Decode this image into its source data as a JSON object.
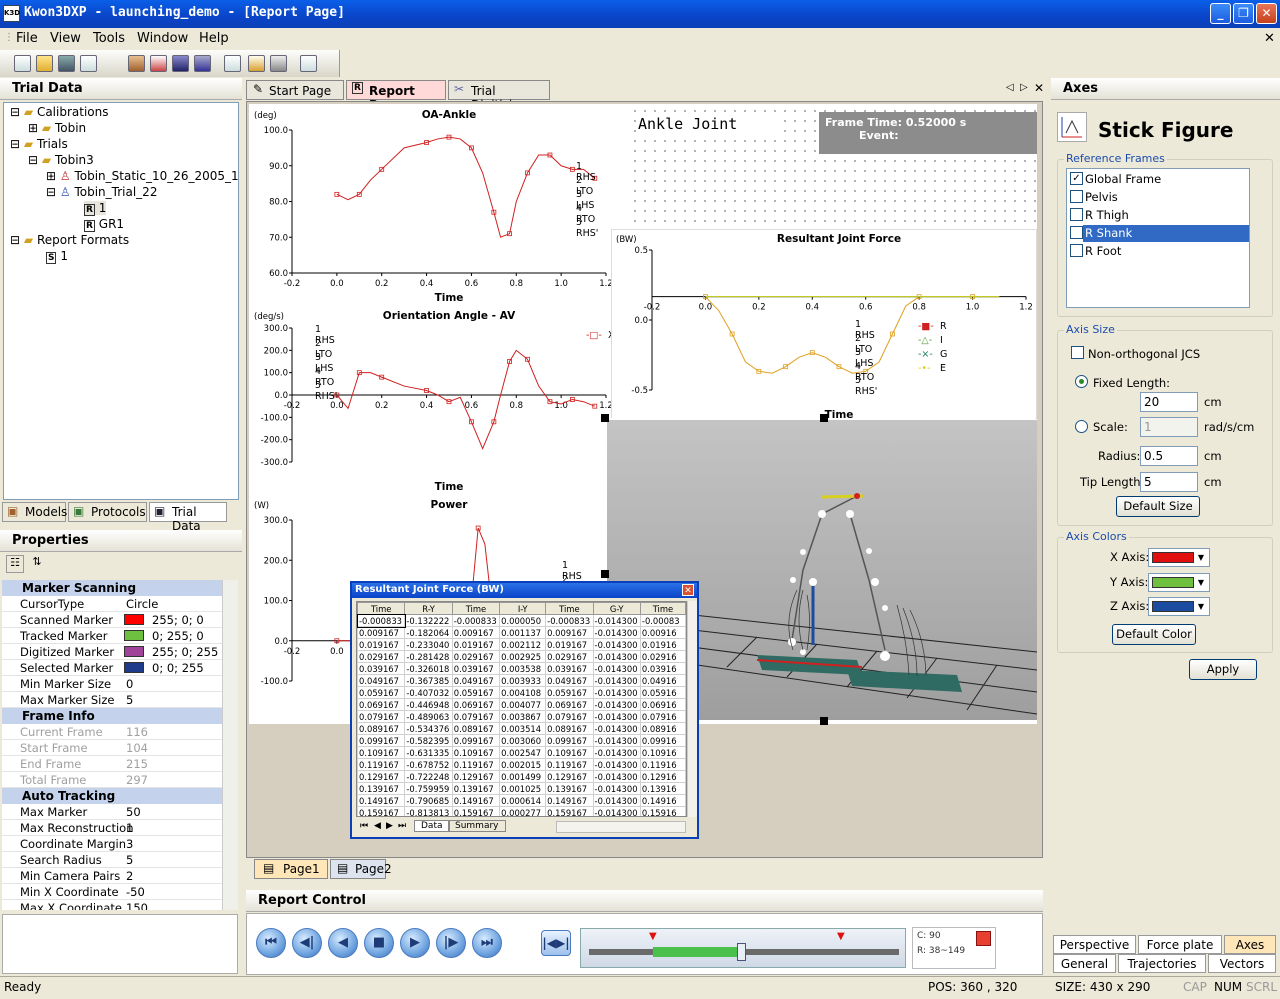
{
  "window": {
    "title": "Kwon3DXP - launching_demo - [Report Page]",
    "app_icon": "K3D"
  },
  "menu": [
    "File",
    "View",
    "Tools",
    "Window",
    "Help"
  ],
  "trial_data": {
    "title": "Trial Data",
    "tree": [
      "Calibrations",
      "Tobin",
      "Trials",
      "Tobin3",
      "Tobin_Static_10_26_2005_1",
      "Tobin_Trial_22",
      "1",
      "GR1",
      "Report Formats",
      "1"
    ]
  },
  "left_tabs": [
    "Models",
    "Protocols",
    "Trial Data"
  ],
  "properties": {
    "title": "Properties",
    "cat1": "Marker Scanning",
    "r1": [
      "CursorType",
      "Circle"
    ],
    "r2": [
      "Scanned Marker",
      "255; 0; 0"
    ],
    "r3": [
      "Tracked Marker",
      "0; 255; 0"
    ],
    "r4": [
      "Digitized Marker",
      "255; 0; 255"
    ],
    "r5": [
      "Selected Marker",
      "0; 0; 255"
    ],
    "r6": [
      "Min Marker Size",
      "0"
    ],
    "r7": [
      "Max Marker Size",
      "5"
    ],
    "cat2": "Frame Info",
    "r8": [
      "Current Frame",
      "116"
    ],
    "r9": [
      "Start Frame",
      "104"
    ],
    "r10": [
      "End Frame",
      "215"
    ],
    "r11": [
      "Total Frame",
      "297"
    ],
    "cat3": "Auto Tracking",
    "r12": [
      "Max Marker",
      "50"
    ],
    "r13": [
      "Max Reconstruction",
      "1"
    ],
    "r14": [
      "Coordinate Margin",
      "3"
    ],
    "r15": [
      "Search Radius",
      "5"
    ],
    "r16": [
      "Min Camera Pairs",
      "2"
    ],
    "r17": [
      "Min X Coordinate",
      "-50"
    ],
    "r18": [
      "Max X Coordinate",
      "150"
    ]
  },
  "doc_tabs": [
    "Start Page",
    "Report Page",
    "Trial Digitizing"
  ],
  "page_tabs": [
    "Page1",
    "Page2"
  ],
  "report_header": {
    "joint": "Ankle Joint",
    "frame_time": "Frame Time: 0.52000 s",
    "event": "Event:"
  },
  "legend_events": [
    "1 RHS",
    "2 LTO",
    "3 LHS",
    "4 RTO",
    "5 RHS'"
  ],
  "chart_data": [
    {
      "type": "line",
      "title": "OA-Ankle",
      "ylabel": "(deg)",
      "xlabel": "Time",
      "xlim": [
        -0.2,
        1.2
      ],
      "ylim": [
        60,
        100
      ],
      "yticks": [
        "100.0",
        "90.0",
        "80.0",
        "70.0",
        "60.0"
      ],
      "xticks": [
        "-0.2",
        "0.0",
        "0.2",
        "0.4",
        "0.6",
        "0.8",
        "1.0",
        "1.2"
      ],
      "x": [
        0.0,
        0.05,
        0.1,
        0.15,
        0.2,
        0.3,
        0.4,
        0.45,
        0.5,
        0.55,
        0.6,
        0.65,
        0.7,
        0.73,
        0.77,
        0.8,
        0.85,
        0.9,
        0.95,
        1.0,
        1.05,
        1.1,
        1.15
      ],
      "y": [
        82,
        80.5,
        82,
        86,
        89,
        95,
        96.5,
        97.5,
        98,
        97.5,
        95,
        88,
        77,
        70,
        71,
        80,
        88,
        93,
        93,
        90,
        89,
        89,
        86.5
      ]
    },
    {
      "type": "line",
      "title": "Orientation Angle - AV",
      "ylabel": "(deg/s)",
      "xlabel": "Time",
      "xlim": [
        -0.2,
        1.2
      ],
      "ylim": [
        -300,
        300
      ],
      "yticks": [
        "300.0",
        "200.0",
        "100.0",
        "0.0",
        "-100.0",
        "-200.0",
        "-300.0"
      ],
      "xticks": [
        "-0.2",
        "0.0",
        "0.2",
        "0.4",
        "0.6",
        "0.8",
        "1.0",
        "1.2"
      ],
      "series": [
        {
          "name": "X",
          "x": [
            0.0,
            0.05,
            0.1,
            0.15,
            0.2,
            0.3,
            0.4,
            0.45,
            0.5,
            0.55,
            0.6,
            0.65,
            0.7,
            0.73,
            0.77,
            0.8,
            0.85,
            0.9,
            0.95,
            1.0,
            1.05,
            1.1,
            1.15
          ],
          "y": [
            0,
            -60,
            100,
            100,
            80,
            40,
            20,
            0,
            -30,
            -10,
            -120,
            -240,
            -120,
            0,
            150,
            200,
            160,
            40,
            -30,
            -40,
            -20,
            -30,
            -50
          ]
        }
      ]
    },
    {
      "type": "line",
      "title": "Power",
      "ylabel": "(W)",
      "xlabel": "Time",
      "xlim": [
        -0.2,
        1.2
      ],
      "ylim": [
        -100,
        300
      ],
      "yticks": [
        "300.0",
        "200.0",
        "100.0",
        "0.0",
        "-100.0"
      ],
      "xticks": [
        "-0.2",
        "0.0"
      ],
      "x": [
        0.0,
        0.1,
        0.2,
        0.3,
        0.4,
        0.5,
        0.55,
        0.6,
        0.63,
        0.66,
        0.7,
        0.75,
        0.8
      ],
      "y": [
        0,
        0,
        0,
        0,
        0,
        0,
        -5,
        100,
        280,
        240,
        40,
        0,
        0
      ]
    },
    {
      "type": "line",
      "title": "Resultant Joint Force",
      "ylabel": "(BW)",
      "xlabel": "Time",
      "xlim": [
        -0.2,
        1.2
      ],
      "ylim": [
        -1.0,
        0.5
      ],
      "yticks": [
        "0.5",
        "0.0",
        "-0.5"
      ],
      "xticks": [
        "-0.2",
        "0.0",
        "0.2",
        "0.4",
        "0.6",
        "0.8",
        "1.0",
        "1.2"
      ],
      "series": [
        {
          "name": "R",
          "x": [
            0.0,
            0.05,
            0.1,
            0.15,
            0.2,
            0.25,
            0.3,
            0.35,
            0.4,
            0.45,
            0.5,
            0.55,
            0.6,
            0.65,
            0.7,
            0.75,
            0.8,
            0.9,
            1.0,
            1.1
          ],
          "y": [
            0,
            -0.15,
            -0.4,
            -0.7,
            -0.8,
            -0.82,
            -0.75,
            -0.65,
            -0.6,
            -0.65,
            -0.75,
            -0.82,
            -0.8,
            -0.7,
            -0.4,
            -0.1,
            0,
            0,
            0,
            0
          ]
        },
        {
          "name": "I",
          "x": [
            0,
            1.1
          ],
          "y": [
            0,
            0
          ]
        },
        {
          "name": "G",
          "x": [
            0,
            1.1
          ],
          "y": [
            0,
            0
          ]
        },
        {
          "name": "E",
          "x": [
            0,
            1.1
          ],
          "y": [
            0,
            0
          ]
        }
      ]
    }
  ],
  "table": {
    "title": "Resultant Joint Force (BW)",
    "headers": [
      "Time",
      "R-Y",
      "Time",
      "I-Y",
      "Time",
      "G-Y",
      "Time"
    ],
    "rows": [
      [
        "-0.000833",
        "-0.132222",
        "-0.000833",
        "0.000050",
        "-0.000833",
        "-0.014300",
        "-0.00083"
      ],
      [
        "0.009167",
        "-0.182064",
        "0.009167",
        "0.001137",
        "0.009167",
        "-0.014300",
        "0.00916"
      ],
      [
        "0.019167",
        "-0.233040",
        "0.019167",
        "0.002112",
        "0.019167",
        "-0.014300",
        "0.01916"
      ],
      [
        "0.029167",
        "-0.281428",
        "0.029167",
        "0.002925",
        "0.029167",
        "-0.014300",
        "0.02916"
      ],
      [
        "0.039167",
        "-0.326018",
        "0.039167",
        "0.003538",
        "0.039167",
        "-0.014300",
        "0.03916"
      ],
      [
        "0.049167",
        "-0.367385",
        "0.049167",
        "0.003933",
        "0.049167",
        "-0.014300",
        "0.04916"
      ],
      [
        "0.059167",
        "-0.407032",
        "0.059167",
        "0.004108",
        "0.059167",
        "-0.014300",
        "0.05916"
      ],
      [
        "0.069167",
        "-0.446948",
        "0.069167",
        "0.004077",
        "0.069167",
        "-0.014300",
        "0.06916"
      ],
      [
        "0.079167",
        "-0.489063",
        "0.079167",
        "0.003867",
        "0.079167",
        "-0.014300",
        "0.07916"
      ],
      [
        "0.089167",
        "-0.534376",
        "0.089167",
        "0.003514",
        "0.089167",
        "-0.014300",
        "0.08916"
      ],
      [
        "0.099167",
        "-0.582395",
        "0.099167",
        "0.003060",
        "0.099167",
        "-0.014300",
        "0.09916"
      ],
      [
        "0.109167",
        "-0.631335",
        "0.109167",
        "0.002547",
        "0.109167",
        "-0.014300",
        "0.10916"
      ],
      [
        "0.119167",
        "-0.678752",
        "0.119167",
        "0.002015",
        "0.119167",
        "-0.014300",
        "0.11916"
      ],
      [
        "0.129167",
        "-0.722248",
        "0.129167",
        "0.001499",
        "0.129167",
        "-0.014300",
        "0.12916"
      ],
      [
        "0.139167",
        "-0.759959",
        "0.139167",
        "0.001025",
        "0.139167",
        "-0.014300",
        "0.13916"
      ],
      [
        "0.149167",
        "-0.790685",
        "0.149167",
        "0.000614",
        "0.149167",
        "-0.014300",
        "0.14916"
      ],
      [
        "0.159167",
        "-0.813813",
        "0.159167",
        "0.000277",
        "0.159167",
        "-0.014300",
        "0.15916"
      ]
    ],
    "sheet_tabs": [
      "Data",
      "Summary"
    ]
  },
  "report_control": {
    "title": "Report Control",
    "c": "C: 90",
    "r": "R: 38~149"
  },
  "axes_panel": {
    "header": "Axes",
    "title": "Stick Figure",
    "ref_frames_label": "Reference Frames",
    "frames": [
      "Global Frame",
      "Pelvis",
      "R Thigh",
      "R Shank",
      "R Foot"
    ],
    "axis_size_label": "Axis Size",
    "nonortho": "Non-orthogonal JCS",
    "fixed_length": "Fixed Length:",
    "fixed_value": "20",
    "cm": "cm",
    "scale": "Scale:",
    "scale_value": "1",
    "rad_unit": "rad/s/cm",
    "radius": "Radius:",
    "radius_value": "0.5",
    "tip": "Tip Length:",
    "tip_value": "5",
    "default_size": "Default Size",
    "axis_colors_label": "Axis Colors",
    "x_axis": "X Axis:",
    "y_axis": "Y Axis:",
    "z_axis": "Z Axis:",
    "default_color": "Default Color",
    "apply": "Apply",
    "colors": {
      "x": "#e01010",
      "y": "#70c040",
      "z": "#1c4ca0"
    }
  },
  "right_tabs": [
    "Perspective",
    "Force plate",
    "Axes",
    "General",
    "Trajectories",
    "Vectors"
  ],
  "status": {
    "ready": "Ready",
    "pos": "POS: 360 , 320",
    "size": "SIZE: 430 x 290",
    "cap": "CAP",
    "num": "NUM",
    "scrl": "SCRL"
  }
}
